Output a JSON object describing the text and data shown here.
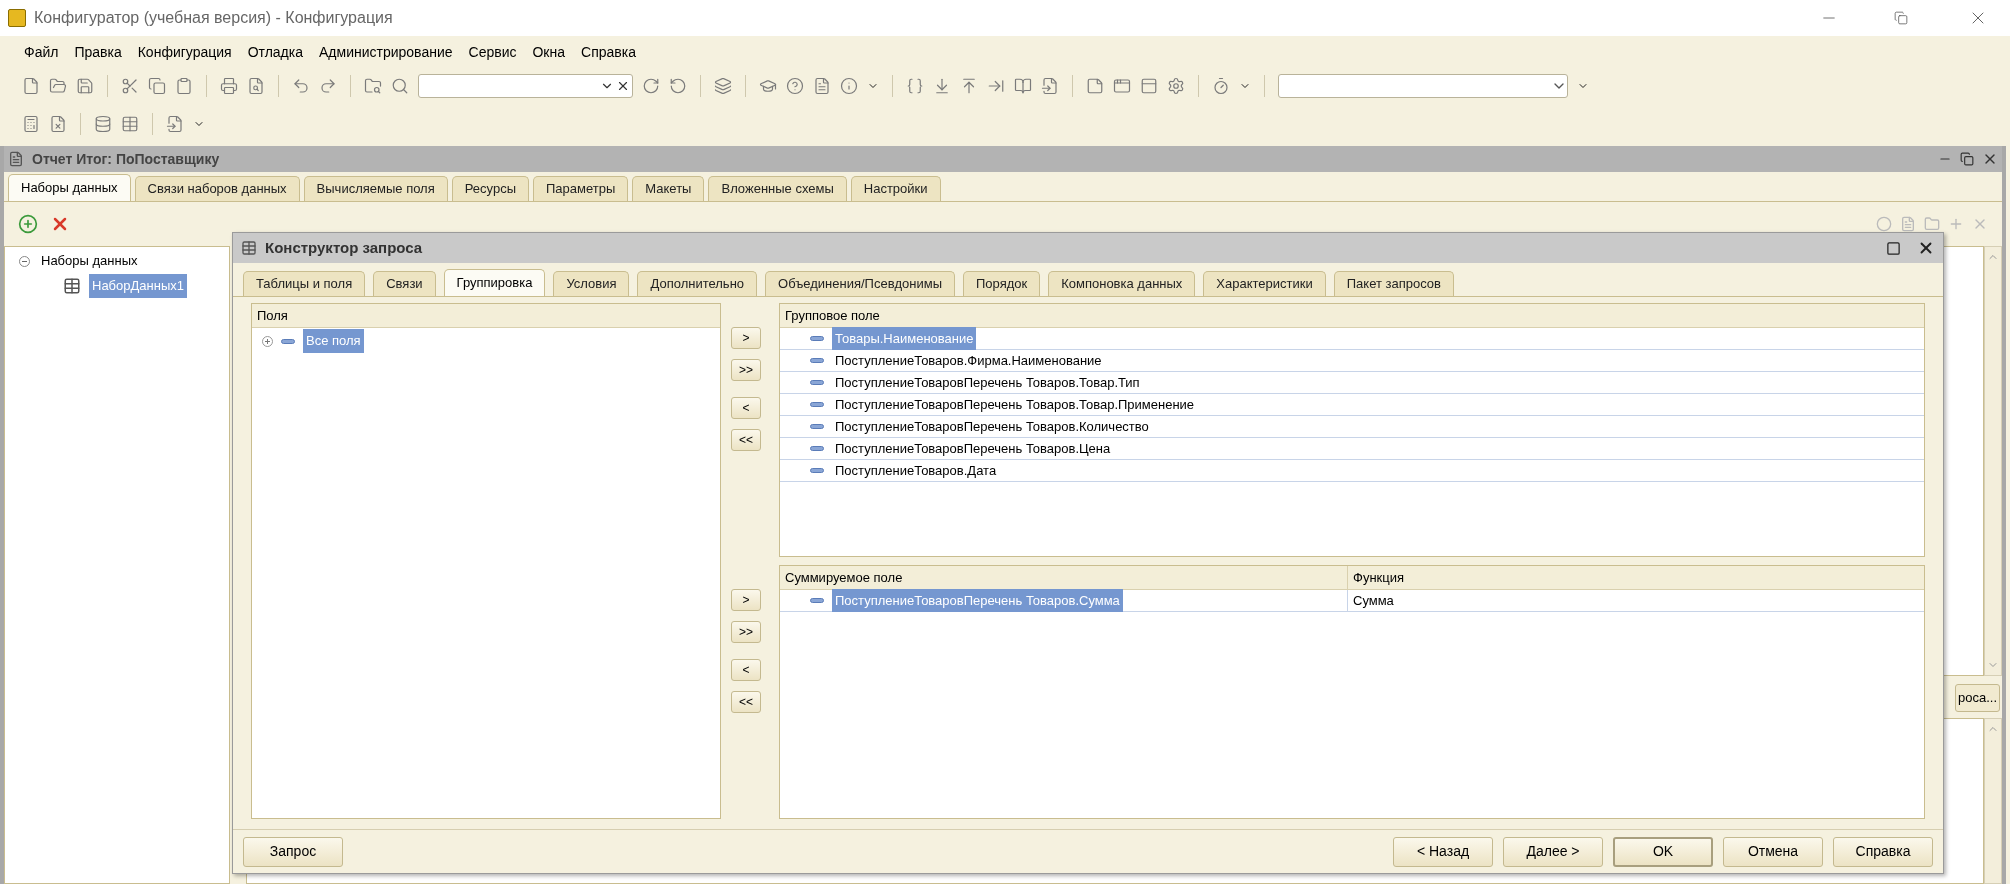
{
  "window": {
    "title": "Конфигуратор (учебная версия) - Конфигурация"
  },
  "menu": [
    {
      "label": "Файл"
    },
    {
      "label": "Правка"
    },
    {
      "label": "Конфигурация"
    },
    {
      "label": "Отладка"
    },
    {
      "label": "Администрирование"
    },
    {
      "label": "Сервис"
    },
    {
      "label": "Окна"
    },
    {
      "label": "Справка"
    }
  ],
  "document": {
    "title": "Отчет Итог: ПоПоставщику",
    "tabs": [
      {
        "label": "Наборы данных",
        "selected": true
      },
      {
        "label": "Связи наборов данных",
        "selected": false
      },
      {
        "label": "Вычисляемые поля",
        "selected": false
      },
      {
        "label": "Ресурсы",
        "selected": false
      },
      {
        "label": "Параметры",
        "selected": false
      },
      {
        "label": "Макеты",
        "selected": false
      },
      {
        "label": "Вложенные схемы",
        "selected": false
      },
      {
        "label": "Настройки",
        "selected": false
      }
    ],
    "tree": [
      {
        "label": "Наборы данных",
        "expanded": true,
        "selected": false,
        "children": [
          {
            "label": "НаборДанных1",
            "selected": true
          }
        ]
      }
    ],
    "side_button": "роса..."
  },
  "dialog": {
    "title": "Конструктор запроса",
    "tabs": [
      {
        "label": "Таблицы и поля",
        "selected": false
      },
      {
        "label": "Связи",
        "selected": false
      },
      {
        "label": "Группировка",
        "selected": true
      },
      {
        "label": "Условия",
        "selected": false
      },
      {
        "label": "Дополнительно",
        "selected": false
      },
      {
        "label": "Объединения/Псевдонимы",
        "selected": false
      },
      {
        "label": "Порядок",
        "selected": false
      },
      {
        "label": "Компоновка данных",
        "selected": false
      },
      {
        "label": "Характеристики",
        "selected": false
      },
      {
        "label": "Пакет запросов",
        "selected": false
      }
    ],
    "fields_panel": {
      "header": "Поля",
      "items": [
        {
          "label": "Все поля",
          "expanded": false,
          "selected": true
        }
      ]
    },
    "group_move_buttons": [
      ">",
      ">>",
      "<",
      "<<"
    ],
    "group_panel": {
      "header": "Групповое поле",
      "rows": [
        {
          "label": "Товары.Наименование",
          "selected": true
        },
        {
          "label": "ПоступлениеТоваров.Фирма.Наименование",
          "selected": false
        },
        {
          "label": "ПоступлениеТоваровПеречень Товаров.Товар.Тип",
          "selected": false
        },
        {
          "label": "ПоступлениеТоваровПеречень Товаров.Товар.Применение",
          "selected": false
        },
        {
          "label": "ПоступлениеТоваровПеречень Товаров.Количество",
          "selected": false
        },
        {
          "label": "ПоступлениеТоваровПеречень Товаров.Цена",
          "selected": false
        },
        {
          "label": "ПоступлениеТоваров.Дата",
          "selected": false
        }
      ]
    },
    "sum_move_buttons": [
      ">",
      ">>",
      "<",
      "<<"
    ],
    "sum_panel": {
      "columns": [
        "Суммируемое поле",
        "Функция"
      ],
      "rows": [
        {
          "field": "ПоступлениеТоваровПеречень Товаров.Сумма",
          "function": "Сумма",
          "selected": true
        }
      ]
    },
    "buttons_left": [
      {
        "label": "Запрос",
        "default": false
      }
    ],
    "buttons_right": [
      {
        "label": "< Назад",
        "default": false
      },
      {
        "label": "Далее >",
        "default": false
      },
      {
        "label": "OK",
        "default": true
      },
      {
        "label": "Отмена",
        "default": false
      },
      {
        "label": "Справка",
        "default": false
      }
    ]
  }
}
